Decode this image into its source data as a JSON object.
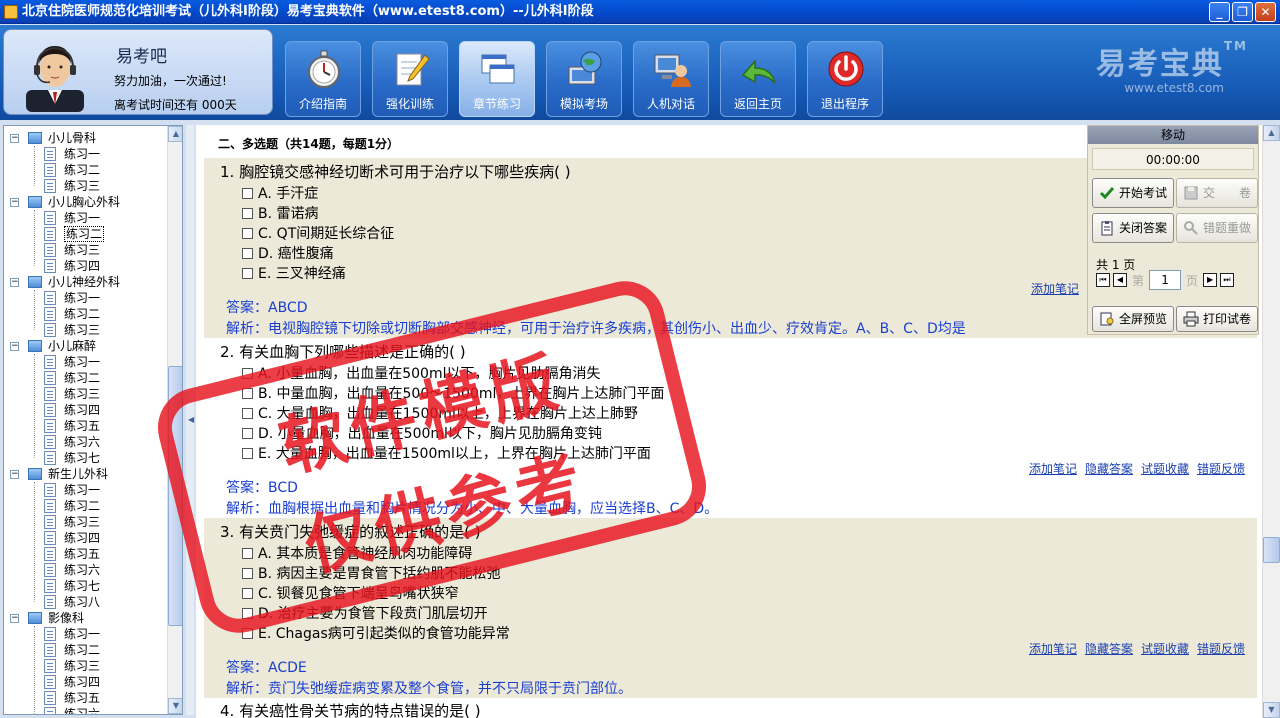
{
  "window": {
    "title": "北京住院医师规范化培训考试（儿外科Ⅰ阶段）易考宝典软件（www.etest8.com）--儿外科Ⅰ阶段",
    "minimize": "_",
    "restore": "❐",
    "close": "✕"
  },
  "profile": {
    "name": "易考吧",
    "slogan": "努力加油，一次通过!",
    "countdown": "离考试时间还有 000天"
  },
  "toolbar": [
    {
      "label": "介绍指南",
      "icon": "stopwatch-icon"
    },
    {
      "label": "强化训练",
      "icon": "notepad-pencil-icon"
    },
    {
      "label": "章节练习",
      "icon": "windows-icon"
    },
    {
      "label": "模拟考场",
      "icon": "globe-computer-icon"
    },
    {
      "label": "人机对话",
      "icon": "user-computer-icon"
    },
    {
      "label": "返回主页",
      "icon": "return-arrow-icon"
    },
    {
      "label": "退出程序",
      "icon": "power-icon"
    }
  ],
  "brand": {
    "name": "易考宝典",
    "tm": "TM",
    "url": "www.etest8.com"
  },
  "tree": {
    "categories": [
      {
        "name": "小儿骨科",
        "items": [
          "练习一",
          "练习二",
          "练习三"
        ]
      },
      {
        "name": "小儿胸心外科",
        "items": [
          "练习一",
          "练习二",
          "练习三",
          "练习四"
        ]
      },
      {
        "name": "小儿神经外科",
        "items": [
          "练习一",
          "练习二",
          "练习三"
        ]
      },
      {
        "name": "小儿麻醉",
        "items": [
          "练习一",
          "练习二",
          "练习三",
          "练习四",
          "练习五",
          "练习六",
          "练习七"
        ]
      },
      {
        "name": "新生儿外科",
        "items": [
          "练习一",
          "练习二",
          "练习三",
          "练习四",
          "练习五",
          "练习六",
          "练习七",
          "练习八"
        ]
      },
      {
        "name": "影像科",
        "items": [
          "练习一",
          "练习二",
          "练习三",
          "练习四",
          "练习五",
          "练习六"
        ]
      }
    ]
  },
  "section": {
    "heading": "二、多选题（共14题，每题1分）"
  },
  "questions": [
    {
      "title": "1. 胸腔镜交感神经切断术可用于治疗以下哪些疾病( )",
      "options": [
        "A. 手汗症",
        "B. 雷诺病",
        "C. QT间期延长综合征",
        "D. 癌性腹痛",
        "E. 三叉神经痛"
      ],
      "answer": "答案：ABCD",
      "analysis": "解析：电视胸腔镜下切除或切断胸部交感神经，可用于治疗许多疾病，其创伤小、出血少、疗效肯定。A、B、C、D均是",
      "links": [
        "添加笔记"
      ]
    },
    {
      "title": "2. 有关血胸下列哪些描述是正确的( )",
      "options": [
        "A. 小量血胸，出血量在500ml以下，胸片见肋膈角消失",
        "B. 中量血胸，出血量在500～1500ml，上界在胸片上达肺门平面",
        "C. 大量血胸，出血量在1500ml以上，上界在胸片上达上肺野",
        "D. 小量血胸，出血量在500ml以下，胸片见肋膈角变钝",
        "E. 大量血胸，出血量在1500ml以上，上界在胸片上达肺门平面"
      ],
      "answer": "答案：BCD",
      "analysis": "解析：血胸根据出血量和胸片情况分为小、中、大量血胸，应当选择B、C、D。",
      "links": [
        "添加笔记",
        "隐藏答案",
        "试题收藏",
        "错题反馈"
      ]
    },
    {
      "title": "3. 有关贲门失弛缓症的叙述正确的是( )",
      "options": [
        "A. 其本质是食管神经肌肉功能障碍",
        "B. 病因主要是胃食管下括约肌不能松弛",
        "C. 钡餐见食管下端呈鸟嘴状狭窄",
        "D. 治疗主要为食管下段贲门肌层切开",
        "E. Chagas病可引起类似的食管功能异常"
      ],
      "answer": "答案：ACDE",
      "analysis": "解析：贲门失弛缓症病变累及整个食管，并不只局限于贲门部位。",
      "links": [
        "添加笔记",
        "隐藏答案",
        "试题收藏",
        "错题反馈"
      ]
    },
    {
      "title": "4. 有关癌性骨关节病的特点错误的是( )"
    }
  ],
  "panel": {
    "move": "移动",
    "timer": "00:00:00",
    "start_exam": "开始考试",
    "submit": "交　　卷",
    "close_answer": "关闭答案",
    "wrong_redo": "错题重做",
    "total_pages": "共 1 页",
    "page_word": "第",
    "page_suffix": "页",
    "page_value": "1",
    "fullscreen": "全屏预览",
    "print": "打印试卷"
  },
  "watermark": {
    "line1": "软件模版",
    "line2": "仅供参考"
  },
  "colors": {
    "accent": "#1559b5",
    "answer": "#1a3fd0",
    "stamp": "#e6141e",
    "shaded": "#ece9d8"
  }
}
